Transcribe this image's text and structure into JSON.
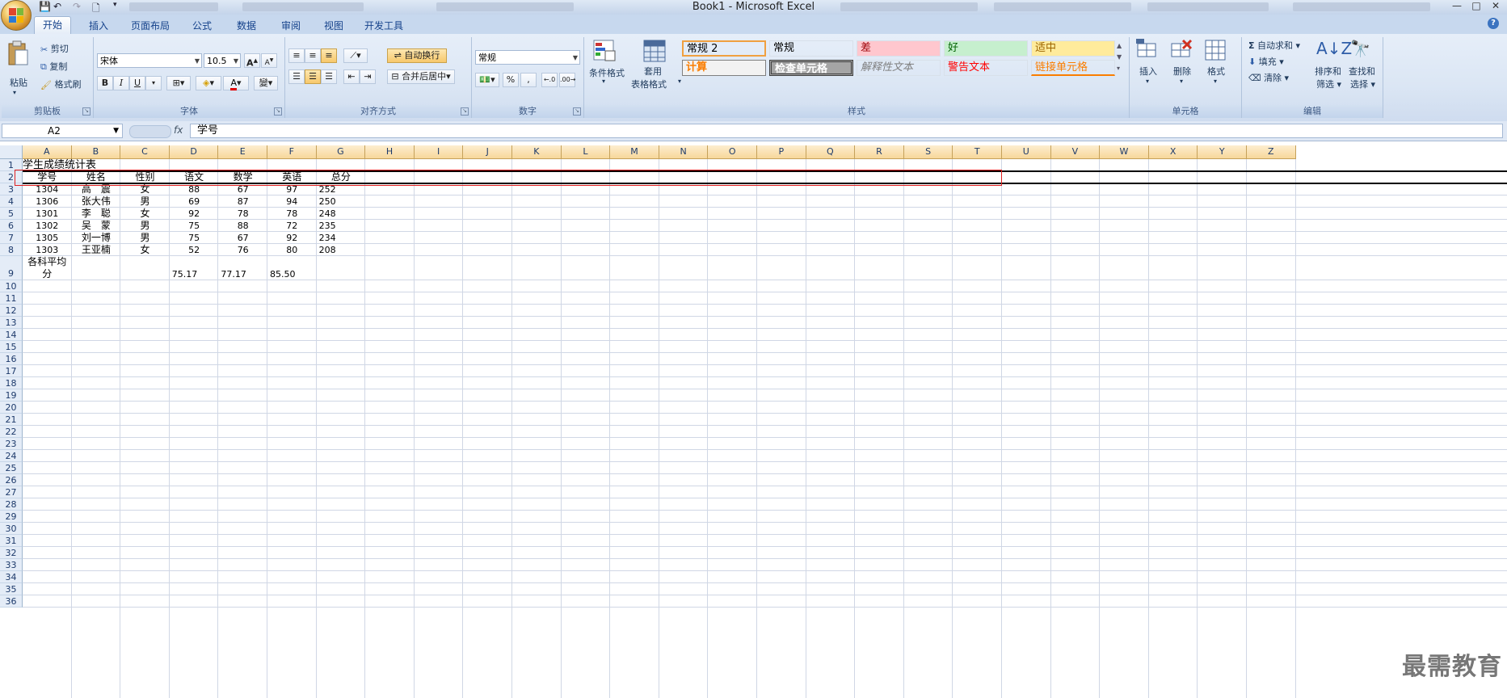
{
  "window": {
    "title": "Book1 - Microsoft Excel",
    "controls": [
      "—",
      "□",
      "✕"
    ]
  },
  "tabs": [
    {
      "label": "开始",
      "active": true
    },
    {
      "label": "插入"
    },
    {
      "label": "页面布局"
    },
    {
      "label": "公式"
    },
    {
      "label": "数据"
    },
    {
      "label": "审阅"
    },
    {
      "label": "视图"
    },
    {
      "label": "开发工具"
    }
  ],
  "ribbon": {
    "clipboard": {
      "label": "剪贴板",
      "paste": "粘贴",
      "cut": "剪切",
      "copy": "复制",
      "format_painter": "格式刷"
    },
    "font": {
      "label": "字体",
      "font_name": "宋体",
      "font_size": "10.5"
    },
    "alignment": {
      "label": "对齐方式",
      "wrap_text": "自动换行",
      "merge_center": "合并后居中"
    },
    "number": {
      "label": "数字",
      "format": "常规"
    },
    "styles": {
      "label": "样式",
      "conditional": "条件格式",
      "table_format_1": "套用",
      "table_format_2": "表格格式",
      "cells": [
        {
          "text": "常规 2",
          "bg": "#ffffff",
          "fg": "#000000",
          "border": "#f0a040"
        },
        {
          "text": "常规",
          "bg": "#ffffff",
          "fg": "#000000"
        },
        {
          "text": "差",
          "bg": "#ffc7ce",
          "fg": "#9c0006"
        },
        {
          "text": "好",
          "bg": "#c6efce",
          "fg": "#006100"
        },
        {
          "text": "适中",
          "bg": "#ffeb9c",
          "fg": "#9c6500"
        },
        {
          "text": "计算",
          "bg": "#f2f2f2",
          "fg": "#fa7d00"
        },
        {
          "text": "检查单元格",
          "bg": "#a5a5a5",
          "fg": "#ffffff"
        },
        {
          "text": "解释性文本",
          "bg": "#ffffff",
          "fg": "#7f7f7f"
        },
        {
          "text": "警告文本",
          "bg": "#ffffff",
          "fg": "#ff0000"
        },
        {
          "text": "链接单元格",
          "bg": "#ffffff",
          "fg": "#fa7d00"
        }
      ]
    },
    "cells": {
      "label": "单元格",
      "insert": "插入",
      "delete": "删除",
      "format": "格式"
    },
    "editing": {
      "label": "编辑",
      "autosum": "自动求和",
      "fill": "填充",
      "clear": "清除",
      "sort_filter_1": "排序和",
      "sort_filter_2": "筛选",
      "find_select_1": "查找和",
      "find_select_2": "选择"
    }
  },
  "formula_bar": {
    "name_box": "A2",
    "fx": "fx",
    "content": "学号"
  },
  "columns": [
    "A",
    "B",
    "C",
    "D",
    "E",
    "F",
    "G",
    "H",
    "I",
    "J",
    "K",
    "L",
    "M",
    "N",
    "O",
    "P",
    "Q",
    "R",
    "S",
    "T",
    "U",
    "V",
    "W",
    "X",
    "Y",
    "Z"
  ],
  "rows": [
    "1",
    "2",
    "3",
    "4",
    "5",
    "6",
    "7",
    "8",
    "9",
    "10",
    "11",
    "12",
    "13",
    "14",
    "15",
    "16",
    "17",
    "18",
    "19",
    "20",
    "21",
    "22",
    "23",
    "24",
    "25",
    "26",
    "27",
    "28",
    "29",
    "30",
    "31",
    "32",
    "33",
    "34",
    "35",
    "36"
  ],
  "sheet": {
    "title": "学生成绩统计表",
    "headers": [
      "学号",
      "姓名",
      "性别",
      "语文",
      "数学",
      "英语",
      "总分"
    ],
    "data": [
      [
        "1304",
        "高　震",
        "女",
        "88",
        "67",
        "97",
        "252"
      ],
      [
        "1306",
        "张大伟",
        "男",
        "69",
        "87",
        "94",
        "250"
      ],
      [
        "1301",
        "李　聪",
        "女",
        "92",
        "78",
        "78",
        "248"
      ],
      [
        "1302",
        "吴　蒙",
        "男",
        "75",
        "88",
        "72",
        "235"
      ],
      [
        "1305",
        "刘一博",
        "男",
        "75",
        "67",
        "92",
        "234"
      ],
      [
        "1303",
        "王亚楠",
        "女",
        "52",
        "76",
        "80",
        "208"
      ]
    ],
    "avg_label_1": "各科平均",
    "avg_label_2": "分",
    "averages": [
      "75.17",
      "77.17",
      "85.50"
    ]
  },
  "watermark": "最需教育"
}
